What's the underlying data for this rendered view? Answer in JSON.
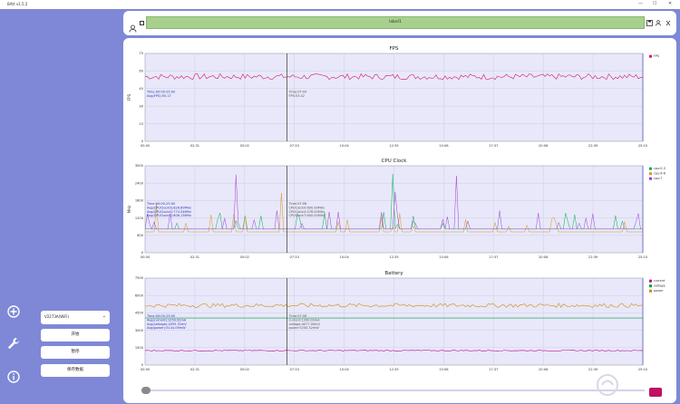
{
  "window": {
    "title": "BAtt v1.5.2",
    "min": "—",
    "max": "☐",
    "close": "✕"
  },
  "sidebar": {
    "icons": [
      "plus-circle-icon",
      "wrench-icon",
      "info-icon"
    ]
  },
  "controls": {
    "device": "V2273A(WiFi)",
    "start_label": "开始",
    "pause_label": "暂停",
    "save_label": "保存数据"
  },
  "header": {
    "label": "label1"
  },
  "colors": {
    "bg": "#7e88d6",
    "plot_bg": "#e8e8fa",
    "fps": "#d81b60",
    "gpu0": "#00b050",
    "gpu4": "#d89820",
    "gpu7": "#a040d0",
    "current": "#c0108a",
    "voltage": "#009e3e",
    "power": "#d08a10"
  },
  "x_ticks": [
    "00:00",
    "02:31",
    "05:02",
    "07:33",
    "10:04",
    "12:35",
    "15:06",
    "17:37",
    "20:08",
    "22:39",
    "25:10"
  ],
  "chart_data": [
    {
      "type": "line",
      "title": "FPS",
      "ylabel": "FPS",
      "ylim": [
        0,
        75
      ],
      "y_ticks": [
        "0",
        "15",
        "30",
        "45",
        "60",
        "75"
      ],
      "series": [
        {
          "name": "FPS",
          "mean": 55.17,
          "min": 52,
          "max": 58
        }
      ],
      "legend": [
        "FPS"
      ],
      "annotation_left": [
        "Time:00:00-25:00",
        "Avg(FPS):55.17"
      ],
      "annotation_cursor": [
        "Time:07:09",
        "FPS:53.42"
      ],
      "cursor_x": "07:09"
    },
    {
      "type": "line",
      "title": "CPU Clock",
      "ylabel": "MHz",
      "ylim": [
        0,
        3000
      ],
      "y_ticks": [
        "0",
        "600",
        "1200",
        "1800",
        "2400",
        "3000"
      ],
      "series": [
        {
          "name": "cpu:0-3",
          "mean": 826.6
        },
        {
          "name": "cpu:4-6",
          "mean": 774.54
        },
        {
          "name": "cpu:7",
          "mean": 806.13
        }
      ],
      "legend": [
        "cpu:0-3",
        "cpu:4-6",
        "cpu:7"
      ],
      "annotation_left": [
        "Time:00:00-25:00",
        "Avg(CPUClock0):826.60MHz",
        "Avg(CPUClock4):774.54MHz",
        "Avg(CPUClock7):806.13MHz"
      ],
      "annotation_cursor": [
        "Time:07:06",
        "CPUClock0:600.00MHz",
        "CPUClock4:576.00MHz",
        "CPUClock7:600.00MHz"
      ],
      "cursor_x": "07:06"
    },
    {
      "type": "line",
      "title": "Battery",
      "ylim": [
        0,
        7500
      ],
      "y_ticks": [
        "0",
        "1500",
        "3000",
        "4500",
        "6000",
        "7500"
      ],
      "series": [
        {
          "name": "current",
          "mean": 1250.92,
          "unit": "mA"
        },
        {
          "name": "voltage",
          "mean": 4055.32,
          "unit": "mV"
        },
        {
          "name": "power",
          "mean": 5144.09,
          "unit": "mW"
        }
      ],
      "legend": [
        "current",
        "voltage",
        "power"
      ],
      "annotation_left": [
        "Time:00:00-25:00",
        "Avg(current):1250.92mA",
        "Avg(voltage):4055.32mV",
        "Avg(power):5144.09mW"
      ],
      "annotation_cursor": [
        "Time:07:06",
        "current:1300.00mA",
        "voltage:4077.00mV",
        "power:5200.32mW"
      ],
      "cursor_x": "07:06"
    }
  ]
}
